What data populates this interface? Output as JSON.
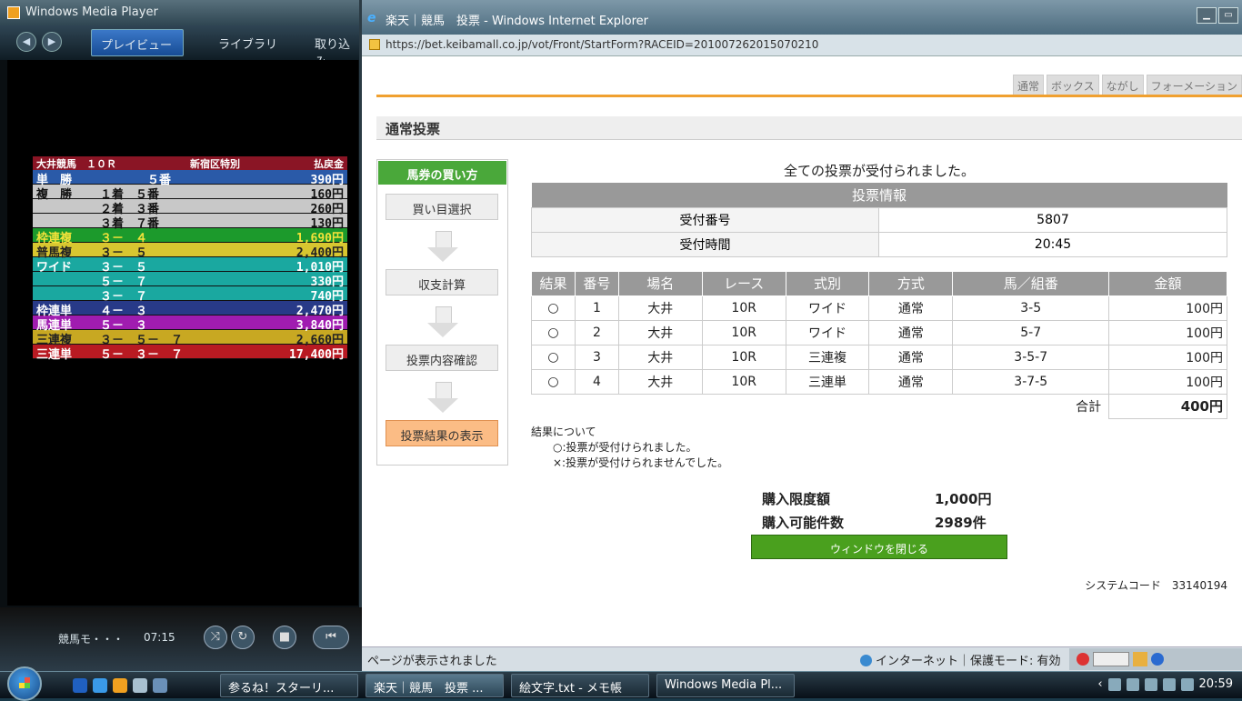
{
  "wmp": {
    "title": "Windows Media Player",
    "tabs": [
      "プレイビュー",
      "ライブラリ",
      "取り込み"
    ],
    "payout": {
      "header": [
        "大井競馬　１０Ｒ",
        "新宿区特別",
        "払戻金"
      ],
      "rows": [
        {
          "type": "単　勝",
          "combo": "　　　　５番",
          "amount": "390円",
          "bg": "#2a5aa8",
          "fg": "#fff"
        },
        {
          "type": "複　勝",
          "combo": "１着　５番",
          "amount": "160円",
          "bg": "#c8c8c8",
          "fg": "#111"
        },
        {
          "type": "",
          "combo": "２着　３番",
          "amount": "260円",
          "bg": "#c8c8c8",
          "fg": "#111"
        },
        {
          "type": "",
          "combo": "３着　７番",
          "amount": "130円",
          "bg": "#c8c8c8",
          "fg": "#111"
        },
        {
          "type": "枠連複",
          "combo": "３－　４",
          "amount": "1,690円",
          "bg": "#1c9a2c",
          "fg": "#f3e23a"
        },
        {
          "type": "普馬複",
          "combo": "３－　５",
          "amount": "2,400円",
          "bg": "#d8c630",
          "fg": "#222"
        },
        {
          "type": "ワイド",
          "combo": "３－　５",
          "amount": "1,010円",
          "bg": "#1aa8a0",
          "fg": "#fff"
        },
        {
          "type": "",
          "combo": "５－　７",
          "amount": "330円",
          "bg": "#1aa8a0",
          "fg": "#fff"
        },
        {
          "type": "",
          "combo": "３－　７",
          "amount": "740円",
          "bg": "#1aa8a0",
          "fg": "#fff"
        },
        {
          "type": "枠連単",
          "combo": "４－　３",
          "amount": "2,470円",
          "bg": "#283a88",
          "fg": "#fff"
        },
        {
          "type": "馬連単",
          "combo": "５－　３",
          "amount": "3,840円",
          "bg": "#a01cb0",
          "fg": "#fff"
        },
        {
          "type": "三連複",
          "combo": "３－　５－　７",
          "amount": "2,660円",
          "bg": "#c8a822",
          "fg": "#222"
        },
        {
          "type": "三連単",
          "combo": "５－　３－　７",
          "amount": "17,400円",
          "bg": "#b81a22",
          "fg": "#fff"
        }
      ]
    },
    "now_playing": "競馬モ・・・",
    "time": "07:15"
  },
  "ie": {
    "title": "楽天｜競馬　投票 - Windows Internet Explorer",
    "url": "https://bet.keibamall.co.jp/vot/Front/StartForm?RACEID=201007262015070210",
    "tabs": [
      "通常",
      "ボックス",
      "ながし",
      "フォーメーション"
    ],
    "section_title": "通常投票",
    "howto": {
      "header": "馬券の買い方",
      "steps": [
        "買い目選択",
        "収支計算",
        "投票内容確認",
        "投票結果の表示"
      ]
    },
    "message": "全ての投票が受付られました。",
    "info": {
      "header": "投票情報",
      "rows": [
        {
          "label": "受付番号",
          "value": "5807"
        },
        {
          "label": "受付時間",
          "value": "20:45"
        }
      ]
    },
    "bets": {
      "columns": [
        "結果",
        "番号",
        "場名",
        "レース",
        "式別",
        "方式",
        "馬／組番",
        "金額"
      ],
      "rows": [
        [
          "○",
          "1",
          "大井",
          "10R",
          "ワイド",
          "通常",
          "3-5",
          "100円"
        ],
        [
          "○",
          "2",
          "大井",
          "10R",
          "ワイド",
          "通常",
          "5-7",
          "100円"
        ],
        [
          "○",
          "3",
          "大井",
          "10R",
          "三連複",
          "通常",
          "3-5-7",
          "100円"
        ],
        [
          "○",
          "4",
          "大井",
          "10R",
          "三連単",
          "通常",
          "3-7-5",
          "100円"
        ]
      ],
      "total_label": "合計",
      "total_value": "400円"
    },
    "notes": {
      "title": "結果について",
      "ok": "○:投票が受付けられました。",
      "ng": "×:投票が受付けられませんでした。"
    },
    "summary": {
      "limit_label": "購入限度額",
      "limit_value": "1,000円",
      "count_label": "購入可能件数",
      "count_value": "2989件"
    },
    "close_button": "ウィンドウを閉じる",
    "system_code": "システムコード　33140194",
    "status": "ページが表示されました",
    "zone": "インターネット｜保護モード: 有効"
  },
  "taskbar": {
    "tasks": [
      "参るね！スターリ...",
      "楽天｜競馬　投票 ...",
      "絵文字.txt - メモ帳",
      "Windows Media Pl..."
    ],
    "clock": "20:59"
  }
}
